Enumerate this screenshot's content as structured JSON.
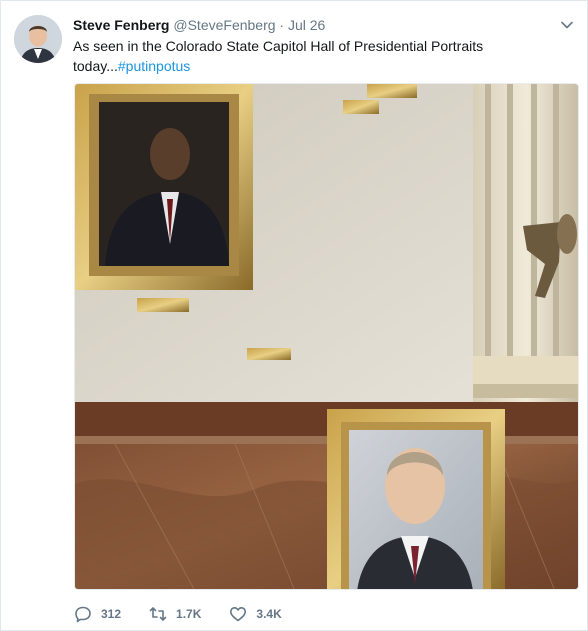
{
  "tweet": {
    "author_name": "Steve Fenberg",
    "handle": "@SteveFenberg",
    "separator": "·",
    "date": "Jul 26",
    "text_line1": "As seen in the Colorado State Capitol Hall of Presidential Portraits",
    "text_line2": "today...",
    "hashtag": "#putinpotus"
  },
  "actions": {
    "replies": "312",
    "retweets": "1.7K",
    "likes": "3.4K"
  },
  "icons": {
    "reply": "reply-icon",
    "retweet": "retweet-icon",
    "like": "heart-icon",
    "menu": "chevron-down-icon"
  },
  "colors": {
    "link": "#1b95e0",
    "muted": "#657786",
    "text": "#14171a"
  }
}
